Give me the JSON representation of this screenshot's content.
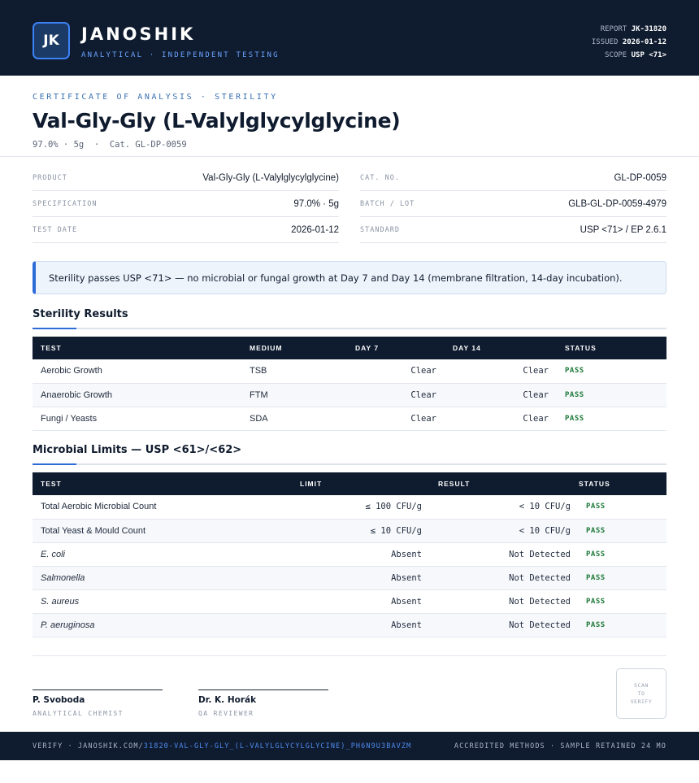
{
  "header": {
    "logo_initials": "JK",
    "brand": "JANOSHIK",
    "tagline": "ANALYTICAL · INDEPENDENT TESTING",
    "meta": [
      {
        "label": "REPORT",
        "value": "JK-31820"
      },
      {
        "label": "ISSUED",
        "value": "2026-01-12"
      },
      {
        "label": "SCOPE",
        "value": "USP <71>"
      }
    ]
  },
  "title_block": {
    "eyebrow": "CERTIFICATE OF ANALYSIS · STERILITY",
    "title": "Val-Gly-Gly (L-Valylglycylglycine)",
    "subline": "97.0% · 5g  ·  Cat. GL-DP-0059"
  },
  "info": {
    "left": [
      {
        "label": "PRODUCT",
        "value": "Val-Gly-Gly (L-Valylglycylglycine)"
      },
      {
        "label": "SPECIFICATION",
        "value": "97.0% · 5g"
      },
      {
        "label": "TEST DATE",
        "value": "2026-01-12"
      }
    ],
    "right": [
      {
        "label": "CAT. NO.",
        "value": "GL-DP-0059"
      },
      {
        "label": "BATCH / LOT",
        "value": "GLB-GL-DP-0059-4979"
      },
      {
        "label": "STANDARD",
        "value": "USP <71> / EP 2.6.1"
      }
    ]
  },
  "callout": "Sterility passes USP <71> — no microbial or fungal growth at Day 7 and Day 14 (membrane filtration, 14-day incubation).",
  "sterility": {
    "title": "Sterility Results",
    "headers": [
      "TEST",
      "MEDIUM",
      "DAY 7",
      "DAY 14",
      "STATUS"
    ],
    "rows": [
      {
        "test": "Aerobic Growth",
        "medium": "TSB",
        "day7": "Clear",
        "day14": "Clear",
        "status": "PASS"
      },
      {
        "test": "Anaerobic Growth",
        "medium": "FTM",
        "day7": "Clear",
        "day14": "Clear",
        "status": "PASS"
      },
      {
        "test": "Fungi / Yeasts",
        "medium": "SDA",
        "day7": "Clear",
        "day14": "Clear",
        "status": "PASS"
      }
    ]
  },
  "microbial": {
    "title": "Microbial Limits — USP <61>/<62>",
    "headers": [
      "TEST",
      "LIMIT",
      "RESULT",
      "STATUS"
    ],
    "rows": [
      {
        "test": "Total Aerobic Microbial Count",
        "limit": "≤ 100 CFU/g",
        "result": "< 10 CFU/g",
        "status": "PASS"
      },
      {
        "test": "Total Yeast & Mould Count",
        "limit": "≤ 10 CFU/g",
        "result": "< 10 CFU/g",
        "status": "PASS"
      },
      {
        "test": "E. coli",
        "limit": "Absent",
        "result": "Not Detected",
        "status": "PASS"
      },
      {
        "test": "Salmonella",
        "limit": "Absent",
        "result": "Not Detected",
        "status": "PASS"
      },
      {
        "test": "S. aureus",
        "limit": "Absent",
        "result": "Not Detected",
        "status": "PASS"
      },
      {
        "test": "P. aeruginosa",
        "limit": "Absent",
        "result": "Not Detected",
        "status": "PASS"
      }
    ]
  },
  "signatures": [
    {
      "name": "P. Svoboda",
      "role": "ANALYTICAL CHEMIST"
    },
    {
      "name": "Dr. K. Horák",
      "role": "QA REVIEWER"
    }
  ],
  "qr_text": "SCAN\nTO\nVERIFY",
  "footer": {
    "verify_prefix": "VERIFY · JANOSHIK.COM/",
    "verify_link": "31820-VAL-GLY-GLY_(L-VALYLGLYCYLGLYCINE)_PH6N9U3BAVZM",
    "right": "ACCREDITED METHODS · SAMPLE RETAINED 24 MO"
  }
}
